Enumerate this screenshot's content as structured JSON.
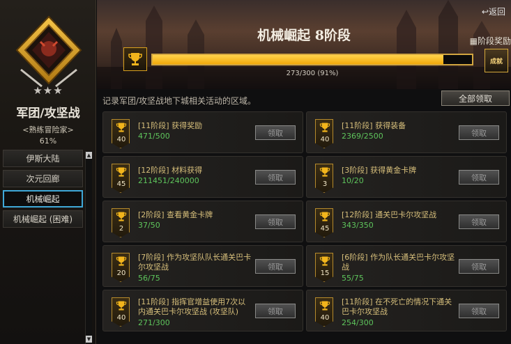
{
  "sidebar": {
    "rank_stars": "★★★",
    "rank_title": "军团/攻坚战",
    "rank_subtitle": "<熟练冒险家>",
    "rank_percent": "61%",
    "items": [
      {
        "label": "伊斯大陆",
        "active": false
      },
      {
        "label": "次元回廊",
        "active": false
      },
      {
        "label": "机械崛起",
        "active": true
      },
      {
        "label": "机械崛起 (困难)",
        "active": false
      }
    ]
  },
  "header": {
    "back_label": "返回",
    "title": "机械崛起 8阶段",
    "stage_reward_label": "阶段奖励",
    "reward_icon_text": "成就"
  },
  "progress": {
    "current": 273,
    "total": 300,
    "fraction": 0.91,
    "text": "273/300 (91%)"
  },
  "main": {
    "description": "记录军团/攻坚战地下城相关活动的区域。",
    "claim_all_label": "全部领取"
  },
  "achievements": [
    {
      "points": "40",
      "title": "[11阶段] 获得奖励",
      "count": "471/500",
      "claim": "领取"
    },
    {
      "points": "40",
      "title": "[11阶段] 获得装备",
      "count": "2369/2500",
      "claim": "领取"
    },
    {
      "points": "45",
      "title": "[12阶段] 材料获得",
      "count": "211451/240000",
      "claim": "领取"
    },
    {
      "points": "3",
      "title": "[3阶段] 获得黄金卡牌",
      "count": "10/20",
      "claim": "领取"
    },
    {
      "points": "2",
      "title": "[2阶段] 查看黄金卡牌",
      "count": "37/50",
      "claim": "领取"
    },
    {
      "points": "45",
      "title": "[12阶段] 通关巴卡尔攻坚战",
      "count": "343/350",
      "claim": "领取"
    },
    {
      "points": "20",
      "title": "[7阶段] 作为攻坚队队长通关巴卡尔攻坚战",
      "count": "56/75",
      "claim": "领取"
    },
    {
      "points": "15",
      "title": "[6阶段] 作为队长通关巴卡尔攻坚战",
      "count": "55/75",
      "claim": "领取"
    },
    {
      "points": "40",
      "title": "[11阶段] 指挥官增益使用7次以内通关巴卡尔攻坚战 (攻坚队)",
      "count": "271/300",
      "claim": "领取"
    },
    {
      "points": "40",
      "title": "[11阶段] 在不死亡的情况下通关巴卡尔攻坚战",
      "count": "254/300",
      "claim": "领取"
    }
  ],
  "colors": {
    "accent_gold": "#f2a90b",
    "count_green": "#5ec55c",
    "active_border": "#3fa8d8"
  }
}
